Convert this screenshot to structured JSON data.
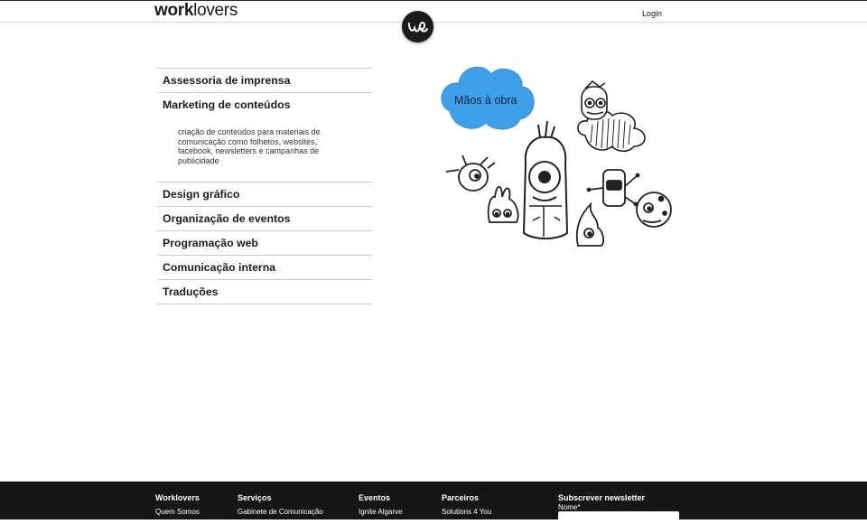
{
  "header": {
    "logo_bold": "work",
    "logo_light": "lovers",
    "login_label": "Login"
  },
  "services": [
    {
      "label": "Assessoria de imprensa"
    },
    {
      "label": "Marketing de conteúdos",
      "description": "criação de conteúdos para materiais de comunicação como folhetos, websites, facebook, newsletters e campanhas de publicidade"
    },
    {
      "label": "Design gráfico"
    },
    {
      "label": "Organização de eventos"
    },
    {
      "label": "Programação web"
    },
    {
      "label": "Comunicação interna"
    },
    {
      "label": "Traduções"
    }
  ],
  "illustration": {
    "cloud_text": "Mãos à obra",
    "cloud_color": "#3fa0ea"
  },
  "footer": {
    "col1_title": "Worklovers",
    "col1_link": "Quem Somos",
    "col2_title": "Serviços",
    "col2_link": "Gabinete de Comunicação",
    "col3_title": "Eventos",
    "col3_link": "Ignite Algarve",
    "col4_title": "Parceiros",
    "col4_link": "Solutions 4 You",
    "newsletter_title": "Subscrever newsletter",
    "newsletter_name_label": "Nome*"
  }
}
